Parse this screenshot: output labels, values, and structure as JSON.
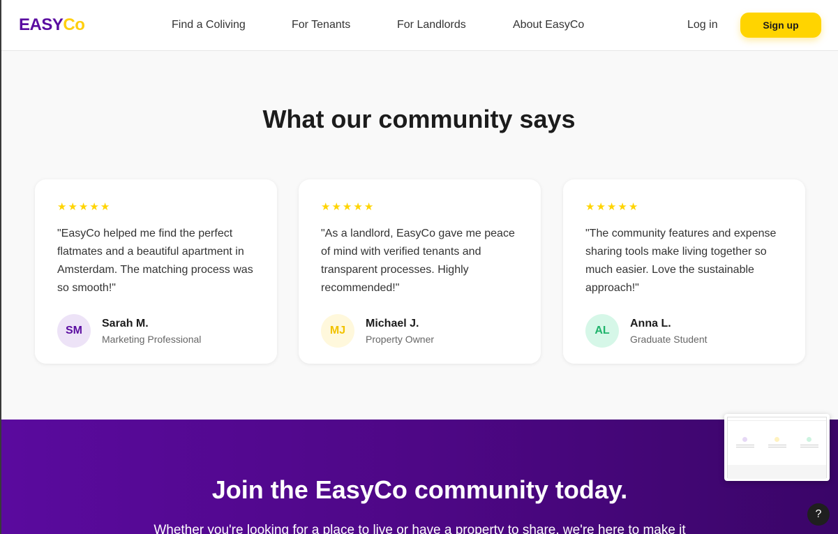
{
  "header": {
    "logo_part1": "EASY",
    "logo_part2": "Co",
    "nav": [
      "Find a Coliving",
      "For Tenants",
      "For Landlords",
      "About EasyCo"
    ],
    "login_label": "Log in",
    "signup_label": "Sign up"
  },
  "testimonials": {
    "title": "What our community says",
    "star_count": 5,
    "items": [
      {
        "quote": "\"EasyCo helped me find the perfect flatmates and a beautiful apartment in Amsterdam. The matching process was so smooth!\"",
        "initials": "SM",
        "name": "Sarah M.",
        "role": "Marketing Professional",
        "avatar_bg": "#ede3f7",
        "avatar_fg": "#5a0ca0"
      },
      {
        "quote": "\"As a landlord, EasyCo gave me peace of mind with verified tenants and transparent processes. Highly recommended!\"",
        "initials": "MJ",
        "name": "Michael J.",
        "role": "Property Owner",
        "avatar_bg": "#fff8dc",
        "avatar_fg": "#f2c200"
      },
      {
        "quote": "\"The community features and expense sharing tools make living together so much easier. Love the sustainable approach!\"",
        "initials": "AL",
        "name": "Anna L.",
        "role": "Graduate Student",
        "avatar_bg": "#d6f7e8",
        "avatar_fg": "#1fb36b"
      }
    ]
  },
  "cta": {
    "title": "Join the EasyCo community today.",
    "subtitle": "Whether you're looking for a place to live or have a property to share, we're here to make it"
  },
  "help_label": "?",
  "colors": {
    "brand_purple": "#5a0ca0",
    "brand_yellow": "#ffd400"
  }
}
